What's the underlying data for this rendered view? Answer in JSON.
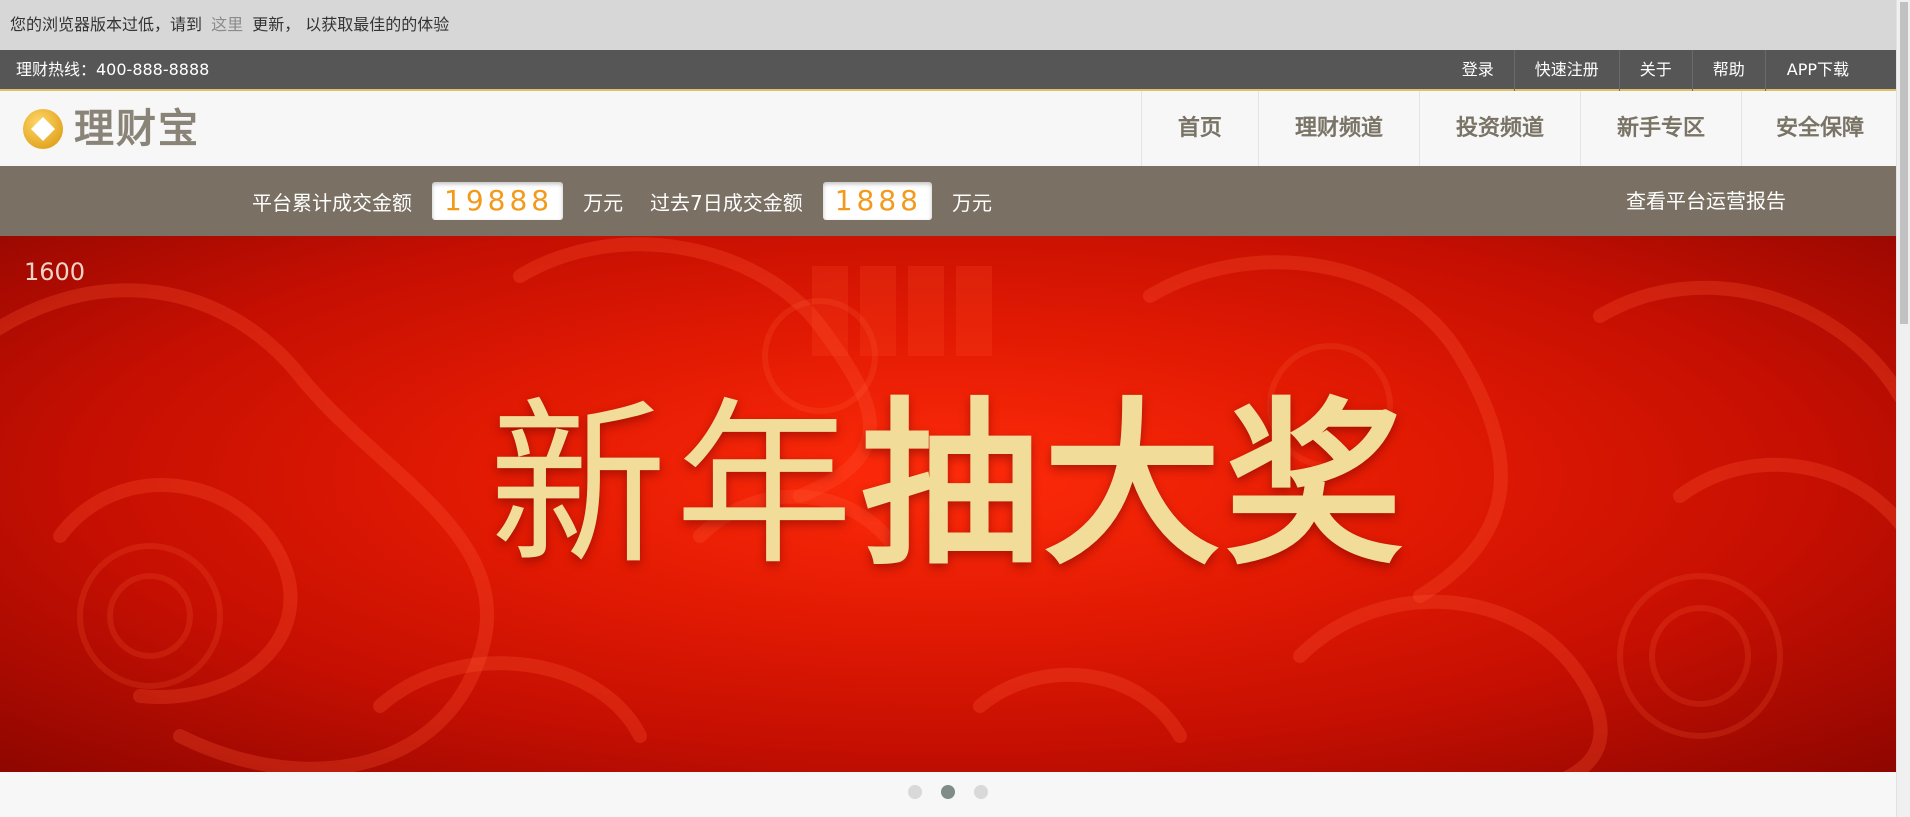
{
  "notice": {
    "before": "您的浏览器版本过低，请到",
    "link": "这里",
    "after": "更新， 以获取最佳的的体验"
  },
  "utilbar": {
    "hotline": "理财热线：400-888-8888",
    "links": [
      "登录",
      "快速注册",
      "关于",
      "帮助",
      "APP下载"
    ]
  },
  "header": {
    "logo_text": "理财宝",
    "nav": [
      "首页",
      "理财频道",
      "投资频道",
      "新手专区",
      "安全保障"
    ]
  },
  "stats": {
    "total_label": "平台累计成交金额",
    "total_value": "19888",
    "total_unit": "万元",
    "week_label": "过去7日成交金额",
    "week_value": "1888",
    "week_unit": "万元",
    "report_link": "查看平台运营报告"
  },
  "banner": {
    "counter": "1600",
    "headline_light": "新年",
    "headline_bold": "抽大奖"
  },
  "carousel": {
    "count": 3,
    "active_index": 1
  },
  "colors": {
    "accent_orange": "#f39a1d",
    "banner_red": "#e21a03",
    "headline_gold": "#f2dc9a",
    "stats_bg": "#7a7063"
  }
}
